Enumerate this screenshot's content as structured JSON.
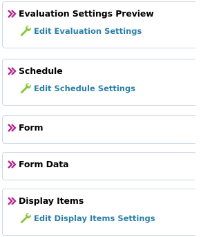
{
  "panels": [
    {
      "title": "Evaluation Settings Preview",
      "link": "Edit Evaluation Settings",
      "chevron_icon": "double-chevron-right-icon",
      "link_icon": "wrench-icon"
    },
    {
      "title": "Schedule",
      "link": "Edit Schedule Settings",
      "chevron_icon": "double-chevron-right-icon",
      "link_icon": "wrench-icon"
    },
    {
      "title": "Form",
      "chevron_icon": "double-chevron-right-icon"
    },
    {
      "title": "Form Data",
      "chevron_icon": "double-chevron-right-icon"
    },
    {
      "title": "Display Items",
      "link": "Edit Display Items Settings",
      "chevron_icon": "double-chevron-right-icon",
      "link_icon": "wrench-icon"
    }
  ],
  "colors": {
    "chevron": "#b3298f",
    "wrench": "#8cc63f",
    "link": "#2a7fa8",
    "border": "#c9d7e6"
  }
}
